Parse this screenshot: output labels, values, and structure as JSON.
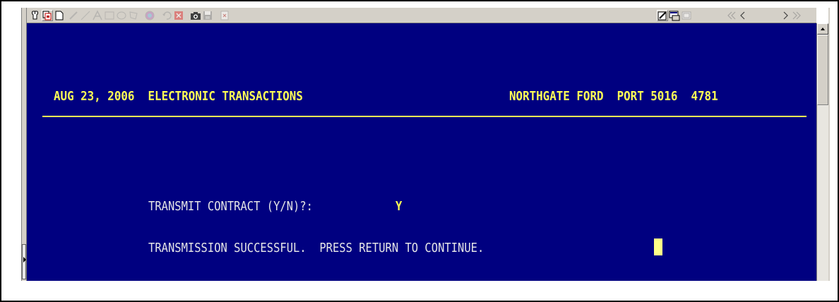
{
  "header": {
    "left_text": "AUG 23, 2006  ELECTRONIC TRANSACTIONS",
    "right_text": "NORTHGATE FORD  PORT 5016  4781"
  },
  "prompt": {
    "label": "TRANSMIT CONTRACT (Y/N)?:",
    "answer": "Y"
  },
  "status": {
    "message": "TRANSMISSION SUCCESSFUL.  PRESS RETURN TO CONTINUE."
  },
  "toolbar": {
    "icons": [
      "mouse-pointer-icon",
      "copy-icon",
      "blank-page-icon",
      "pen-icon",
      "line-icon",
      "text-a-icon",
      "rectangle-icon",
      "ellipse-icon",
      "polygon-icon",
      "color-icon",
      "undo-icon",
      "delete-icon",
      "camera-icon",
      "save-icon",
      "close-doc-icon",
      "edit-icon",
      "screen-icon",
      "window-icon",
      "rewind-icon",
      "back-icon",
      "forward-icon",
      "fast-forward-icon"
    ]
  },
  "colors": {
    "screen_background": "#000080",
    "header_text": "#ffff55",
    "body_text": "#e6e6e6",
    "cursor": "#ffff88",
    "toolbar": "#d4d0c8"
  }
}
